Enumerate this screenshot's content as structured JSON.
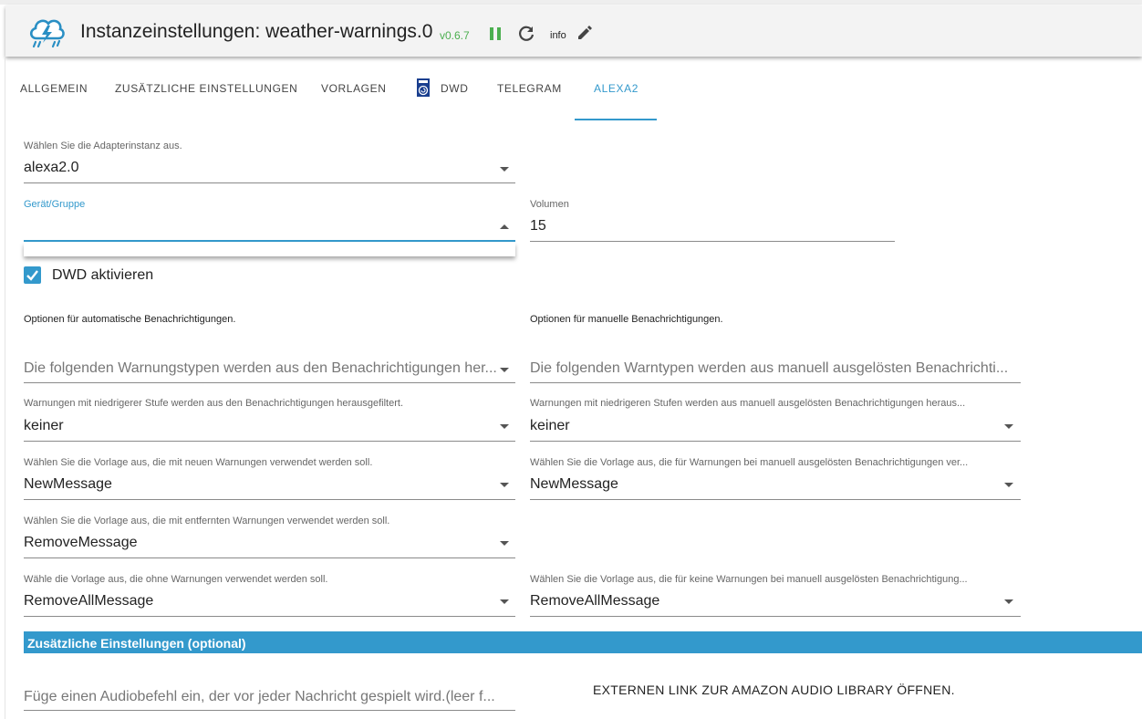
{
  "header": {
    "title": "Instanzeinstellungen: weather-warnings.0",
    "version": "v0.6.7",
    "info_label": "info",
    "icons": [
      "weather-cloud-logo",
      "pause-icon",
      "refresh-icon",
      "edit-icon"
    ],
    "colors": {
      "version": "#4caf50",
      "pause": "#4caf50"
    }
  },
  "tabs": [
    {
      "label": "ALLGEMEIN"
    },
    {
      "label": "ZUSÄTZLICHE EINSTELLUNGEN"
    },
    {
      "label": "VORLAGEN"
    },
    {
      "label": "DWD"
    },
    {
      "label": "TELEGRAM"
    },
    {
      "label": "ALEXA2",
      "active": true
    }
  ],
  "accent_color": "#3399cc",
  "form": {
    "adapter_instance": {
      "label": "Wählen Sie die Adapterinstanz aus.",
      "value": "alexa2.0"
    },
    "device_group": {
      "label": "Gerät/Gruppe",
      "value": ""
    },
    "volume": {
      "label": "Volumen",
      "value": "15"
    },
    "dwd_enable": {
      "label": "DWD aktivieren",
      "checked": true
    },
    "auto_section": "Optionen für automatische Benachrichtigungen.",
    "manual_section": "Optionen für manuelle Benachrichtigungen.",
    "auto_types": {
      "placeholder": "Die folgenden Warnungstypen werden aus den Benachrichtigungen her..."
    },
    "manual_types": {
      "placeholder": "Die folgenden Warntypen werden aus manuell ausgelösten Benachrichti..."
    },
    "auto_level": {
      "label": "Warnungen mit niedrigerer Stufe werden aus den Benachrichtigungen herausgefiltert.",
      "value": "keiner"
    },
    "manual_level": {
      "label": "Warnungen mit niedrigeren Stufen werden aus manuell ausgelösten Benachrichtigungen heraus...",
      "value": "keiner"
    },
    "auto_new_template": {
      "label": "Wählen Sie die Vorlage aus, die mit neuen Warnungen verwendet werden soll.",
      "value": "NewMessage"
    },
    "manual_new_template": {
      "label": "Wählen Sie die Vorlage aus, die für Warnungen bei manuell ausgelösten Benachrichtigungen ver...",
      "value": "NewMessage"
    },
    "auto_removed_template": {
      "label": "Wählen Sie die Vorlage aus, die mit entfernten Warnungen verwendet werden soll.",
      "value": "RemoveMessage"
    },
    "auto_none_template": {
      "label": "Wähle die Vorlage aus, die ohne Warnungen verwendet werden soll.",
      "value": "RemoveAllMessage"
    },
    "manual_none_template": {
      "label": "Wählen Sie die Vorlage aus, die für keine Warnungen bei manuell ausgelösten Benachrichtigung...",
      "value": "RemoveAllMessage"
    }
  },
  "optional_section": {
    "title": "Zusätzliche Einstellungen (optional)",
    "audio_command": {
      "placeholder": "Füge einen Audiobefehl ein, der vor jeder Nachricht gespielt wird.(leer f..."
    },
    "external_link": "EXTERNEN LINK ZUR AMAZON AUDIO LIBRARY ÖFFNEN."
  }
}
